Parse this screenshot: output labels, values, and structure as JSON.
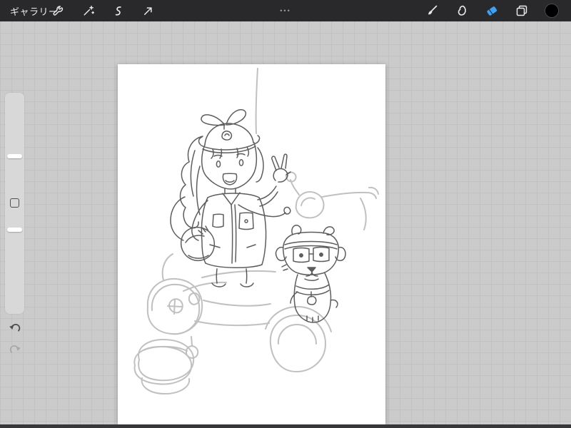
{
  "topbar": {
    "gallery_label": "ギャラリー",
    "more_dots": "•••"
  },
  "icons": {
    "topbar_left": [
      "wrench-icon",
      "adjustments-wand-icon",
      "selection-icon",
      "transform-arrow-icon"
    ],
    "topbar_right": [
      "brush-icon",
      "smudge-icon",
      "eraser-icon",
      "layers-icon",
      "color-swatch"
    ],
    "sidebar": [
      "brush-size-slider",
      "modify-button",
      "opacity-slider",
      "undo-icon",
      "redo-icon"
    ]
  },
  "colors": {
    "topbar_bg": "#29292c",
    "active_tool_blue": "#3fa1f6",
    "workspace_bg": "#cbcbcb",
    "canvas_bg": "#ffffff",
    "sidebar_bg": "#d8d8d8",
    "current_color_swatch": "#000000"
  },
  "canvas": {
    "content_description": "rough pencil sketch: chibi girl with cap and ponytail making a peace sign holding a helmet, a dog wearing goggles beside her, over a light sketch of a scooter with wheels and basket"
  }
}
